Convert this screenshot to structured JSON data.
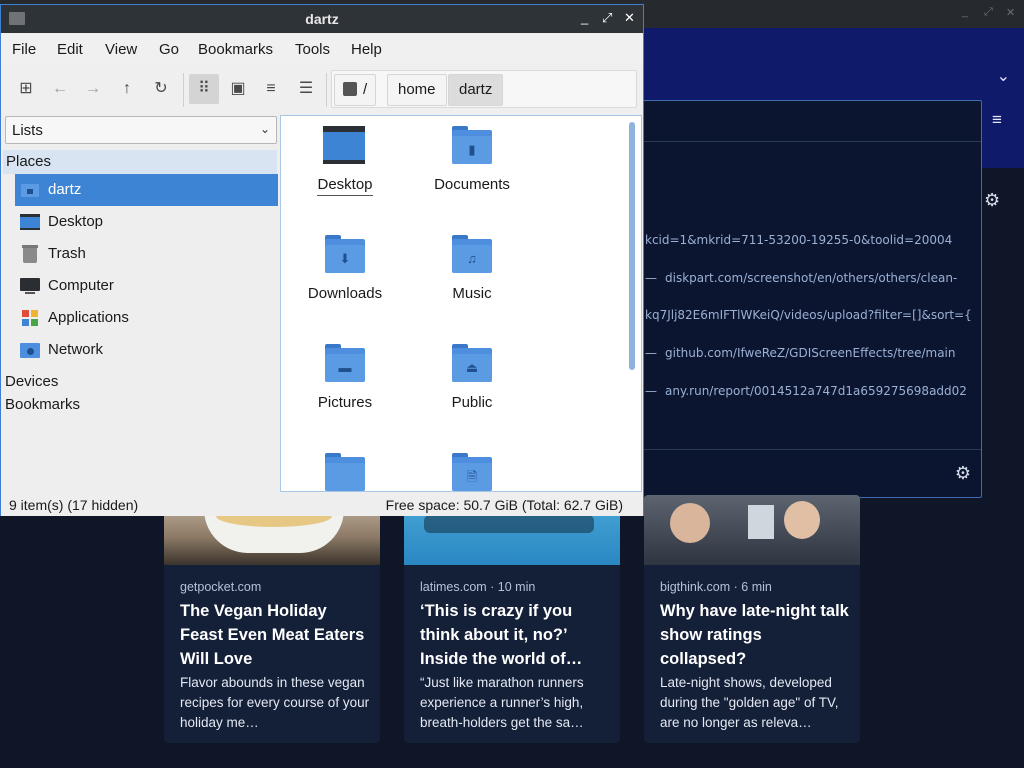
{
  "file_manager": {
    "title": "dartz",
    "menu": [
      "File",
      "Edit",
      "View",
      "Go",
      "Bookmarks",
      "Tools",
      "Help"
    ],
    "breadcrumb": [
      "/",
      "home",
      "dartz"
    ],
    "side_pane_mode": "Lists",
    "sidebar": {
      "places_label": "Places",
      "items": [
        {
          "label": "dartz",
          "icon": "home-folder-icon",
          "selected": true
        },
        {
          "label": "Desktop",
          "icon": "desktop-icon"
        },
        {
          "label": "Trash",
          "icon": "trash-icon"
        },
        {
          "label": "Computer",
          "icon": "computer-icon"
        },
        {
          "label": "Applications",
          "icon": "applications-icon"
        },
        {
          "label": "Network",
          "icon": "network-icon"
        }
      ],
      "devices_label": "Devices",
      "bookmarks_label": "Bookmarks"
    },
    "files": [
      {
        "label": "Desktop",
        "icon": "desktop-folder-icon"
      },
      {
        "label": "Documents",
        "icon": "documents-folder-icon"
      },
      {
        "label": "Downloads",
        "icon": "downloads-folder-icon"
      },
      {
        "label": "Music",
        "icon": "music-folder-icon"
      },
      {
        "label": "Pictures",
        "icon": "pictures-folder-icon"
      },
      {
        "label": "Public",
        "icon": "public-folder-icon"
      },
      {
        "label": "",
        "icon": "folder-icon"
      },
      {
        "label": "",
        "icon": "templates-folder-icon"
      }
    ],
    "status": {
      "items": "9 item(s) (17 hidden)",
      "free_space": "Free space: 50.7 GiB (Total: 62.7 GiB)"
    }
  },
  "browser": {
    "history": [
      "kcid=1&mkrid=711-53200-19255-0&toolid=20004",
      "diskpart.com/screenshot/en/others/others/clean-",
      "kq7Jlj82E6mIFTlWKeiQ/videos/upload?filter=[]&sort={",
      "github.com/IfweReZ/GDIScreenEffects/tree/main",
      "any.run/report/0014512a747d1a659275698add02"
    ],
    "cards": [
      {
        "source": "getpocket.com",
        "title": "The Vegan Holiday Feast Even Meat Eaters Will Love",
        "excerpt": "Flavor abounds in these vegan recipes for every course of your holiday me…"
      },
      {
        "source": "latimes.com · 10 min",
        "title": "‘This is crazy if you think about it, no?’ Inside the world of…",
        "excerpt": "“Just like marathon runners experience a runner’s high, breath-holders get the sa…"
      },
      {
        "source": "bigthink.com · 6 min",
        "title": "Why have late-night talk show ratings collapsed?",
        "excerpt": "Late-night shows, developed during the \"golden age\" of TV, are no longer as releva…"
      }
    ]
  }
}
